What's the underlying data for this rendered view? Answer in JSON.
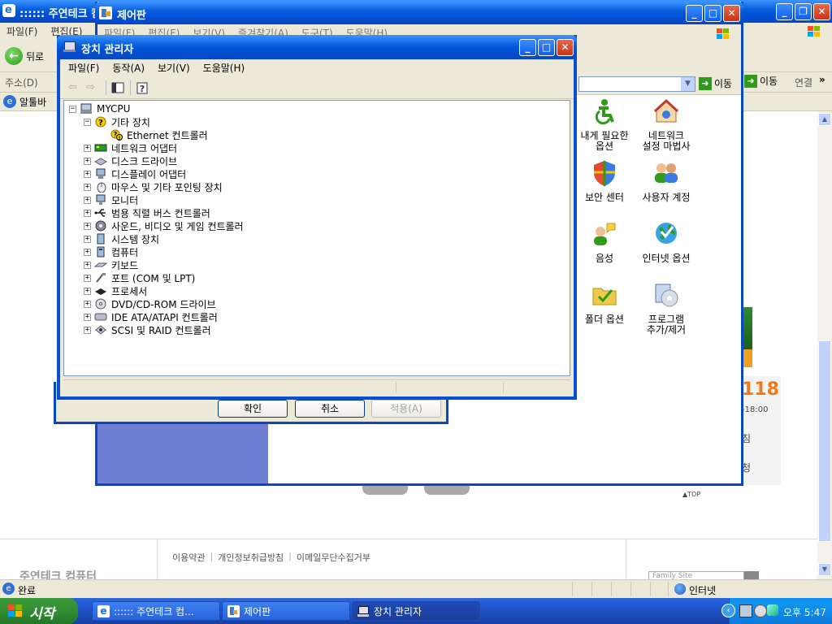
{
  "browser": {
    "title": ":::::: 주연테크 컴퓨터",
    "menu": [
      "파일(F)",
      "편집(E)"
    ],
    "back_label": "뒤로",
    "address_label": "주소(D)",
    "links_label": "알툴바",
    "go_label": "이동",
    "links_right": "연결",
    "status_text": "완료",
    "zone_text": "인터넷",
    "phone_digits": "118",
    "hours_text": "-18:00",
    "side_text_1": "침",
    "side_text_2": "청",
    "top_link": "▲TOP",
    "footer_links": [
      "이용약관",
      "개인정보취급방침",
      "이메일무단수집거부"
    ],
    "family_site_placeholder": "Family Site",
    "footer_logo": "주연테크 컴퓨터"
  },
  "control_panel": {
    "title": "제어판",
    "menu": [
      "파일(F)",
      "편집(E)",
      "보기(V)",
      "즐겨찾기(A)",
      "도구(T)",
      "도움말(H)"
    ],
    "go_label": "이동",
    "icons": [
      {
        "label": "내게 필요한\n옵션",
        "icon": "accessibility-icon"
      },
      {
        "label": "네트워크\n설정 마법사",
        "icon": "network-wizard-icon"
      },
      {
        "label": "보안 센터",
        "icon": "security-center-icon"
      },
      {
        "label": "사용자 계정",
        "icon": "user-accounts-icon"
      },
      {
        "label": "음성",
        "icon": "speech-icon"
      },
      {
        "label": "인터넷 옵션",
        "icon": "internet-options-icon"
      },
      {
        "label": "폴더 옵션",
        "icon": "folder-options-icon"
      },
      {
        "label": "프로그램\n추가/제거",
        "icon": "add-remove-programs-icon"
      }
    ]
  },
  "display_props": {
    "ok_label": "확인",
    "cancel_label": "취소",
    "apply_label": "적용(A)"
  },
  "device_manager": {
    "title": "장치 관리자",
    "menu": [
      "파일(F)",
      "동작(A)",
      "보기(V)",
      "도움말(H)"
    ],
    "root": "MYCPU",
    "other_devices": "기타 장치",
    "other_child": "Ethernet 컨트롤러",
    "categories": [
      {
        "label": "네트워크 어댑터",
        "icon": "network-adapter-icon"
      },
      {
        "label": "디스크 드라이브",
        "icon": "disk-drive-icon"
      },
      {
        "label": "디스플레이 어댑터",
        "icon": "display-adapter-icon"
      },
      {
        "label": "마우스 및 기타 포인팅 장치",
        "icon": "mouse-icon"
      },
      {
        "label": "모니터",
        "icon": "monitor-icon"
      },
      {
        "label": "범용 직렬 버스 컨트롤러",
        "icon": "usb-icon"
      },
      {
        "label": "사운드, 비디오 및 게임 컨트롤러",
        "icon": "sound-icon"
      },
      {
        "label": "시스템 장치",
        "icon": "system-device-icon"
      },
      {
        "label": "컴퓨터",
        "icon": "computer-icon"
      },
      {
        "label": "키보드",
        "icon": "keyboard-icon"
      },
      {
        "label": "포트 (COM 및 LPT)",
        "icon": "port-icon"
      },
      {
        "label": "프로세서",
        "icon": "processor-icon"
      },
      {
        "label": "DVD/CD-ROM 드라이브",
        "icon": "cdrom-icon"
      },
      {
        "label": "IDE ATA/ATAPI 컨트롤러",
        "icon": "ide-icon"
      },
      {
        "label": "SCSI 및 RAID 컨트롤러",
        "icon": "scsi-icon"
      }
    ]
  },
  "taskbar": {
    "start_label": "시작",
    "tasks": [
      {
        "label": ":::::: 주연테크 컴...",
        "icon": "ie-icon"
      },
      {
        "label": "제어판",
        "icon": "control-panel-icon"
      },
      {
        "label": "장치 관리자",
        "icon": "device-manager-icon"
      }
    ],
    "clock": "오후 5:47"
  },
  "colors": {
    "xp_blue": "#0a47c2",
    "start_green": "#2f8a2f",
    "phone_orange": "#f07a1a"
  }
}
